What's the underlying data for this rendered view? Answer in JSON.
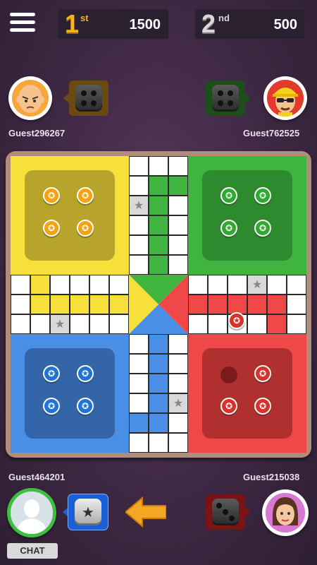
{
  "top_bar": {
    "first": {
      "rank_num": "1",
      "rank_suffix": "st",
      "score": "1500"
    },
    "second": {
      "rank_num": "2",
      "rank_suffix": "nd",
      "score": "500"
    }
  },
  "players": {
    "top_left": {
      "name": "Guest296267",
      "color": "#f4a30f"
    },
    "top_right": {
      "name": "Guest762525",
      "color": "#2eaa2e"
    },
    "bottom_left": {
      "name": "Guest464201",
      "color": "#1f74d8"
    },
    "bottom_right": {
      "name": "Guest215038",
      "color": "#d8302a"
    }
  },
  "board_colors": {
    "yellow": "#f7e03a",
    "green": "#3fb53f",
    "blue": "#4a8fe6",
    "red": "#f04848",
    "yellow_home": "#b8a42a",
    "green_home": "#2e8a2e",
    "blue_home": "#3465a8",
    "red_home": "#b03030"
  },
  "turn_indicator": {
    "icon": "arrow-left-icon",
    "color": "#f5a623"
  },
  "chat": {
    "label": "CHAT"
  }
}
